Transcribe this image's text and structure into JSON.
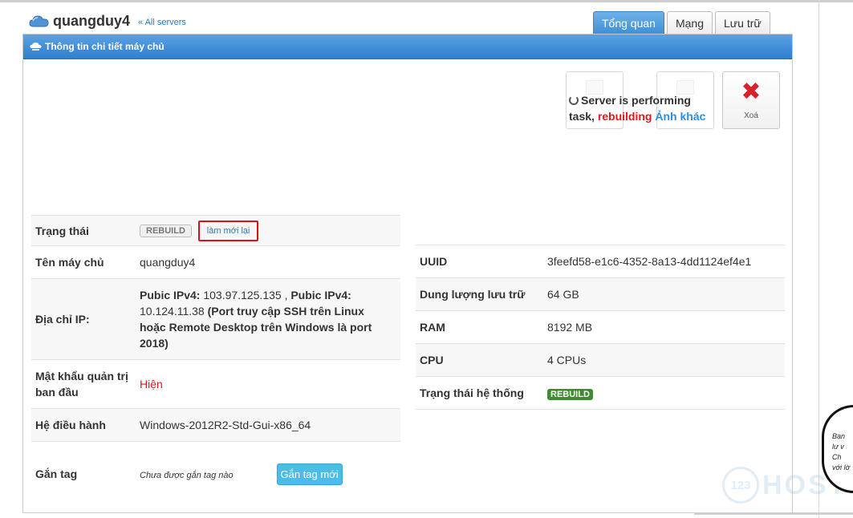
{
  "header": {
    "server_name": "quangduy4",
    "all_servers_link": "« All servers"
  },
  "tabs": [
    {
      "label": "Tổng quan",
      "active": true
    },
    {
      "label": "Mạng",
      "active": false
    },
    {
      "label": "Lưu trữ",
      "active": false
    }
  ],
  "panel": {
    "title": "Thông tin chi tiết máy chủ"
  },
  "actions": {
    "performing_text": "Server is performing task,",
    "task_name": "rebuilding",
    "other_image_link": "Ảnh khác",
    "delete_label": "Xoá"
  },
  "left_details": {
    "status": {
      "label": "Trạng thái",
      "badge": "REBUILD",
      "refresh_link": "làm mới lại"
    },
    "hostname": {
      "label": "Tên máy chủ",
      "value": "quangduy4"
    },
    "ip": {
      "label": "Địa chỉ IP:",
      "ipv4_label_1": "Pubic IPv4:",
      "ipv4_value_1": " 103.97.125.135 , ",
      "ipv4_label_2": "Pubic IPv4:",
      "ipv4_value_2": " 10.124.11.38 ",
      "ssh_note": "(Port truy cập SSH trên Linux hoặc Remote Desktop trên Windows là port 2018)"
    },
    "admin_password": {
      "label": "Mật khẩu quản trị ban đầu",
      "link": "Hiện"
    },
    "os": {
      "label": "Hệ điều hành",
      "value": "Windows-2012R2-Std-Gui-x86_64"
    },
    "tag": {
      "label": "Gắn tag",
      "empty_text": "Chưa được gắn tag nào",
      "button": "Gắn tag mới"
    }
  },
  "right_details": {
    "uuid": {
      "label": "UUID",
      "value": "3feefd58-e1c6-4352-8a13-4dd1124ef4e1"
    },
    "storage": {
      "label": "Dung lượng lưu trữ",
      "value": "64 GB"
    },
    "ram": {
      "label": "RAM",
      "value": "8192 MB"
    },
    "cpu": {
      "label": "CPU",
      "value": "4 CPUs"
    },
    "system_status": {
      "label": "Trạng thái hệ thống",
      "badge": "REBUILD"
    }
  },
  "watermark": {
    "logo_number": "123",
    "logo_text": "HOST"
  },
  "sticker": {
    "lines": [
      "Bạn",
      "lư v",
      "Ch",
      "với lờ"
    ]
  },
  "colors": {
    "primary_blue": "#3d8fd4",
    "danger_red": "#e5171d",
    "success_green": "#3d8c2e",
    "link_blue": "#2a7ab8"
  },
  "icons": {
    "header": "cloud-icon",
    "panel": "server-cloud-icon",
    "delete": "close-x-icon",
    "loading": "spinner-icon"
  }
}
